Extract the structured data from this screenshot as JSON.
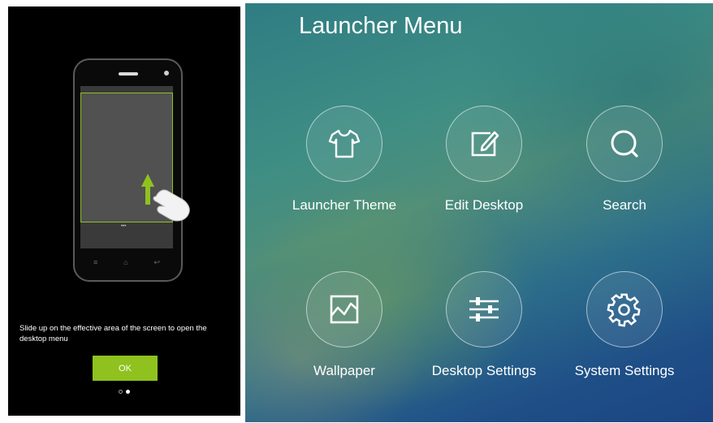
{
  "tutorial": {
    "instruction": "Slide up on the effective area of the screen to open the desktop menu",
    "ok_label": "OK",
    "phone_page_dots": "•••"
  },
  "launcher_menu": {
    "title": "Launcher Menu",
    "items": [
      {
        "label": "Launcher Theme",
        "icon": "tshirt-icon"
      },
      {
        "label": "Edit Desktop",
        "icon": "edit-icon"
      },
      {
        "label": "Search",
        "icon": "search-icon"
      },
      {
        "label": "Wallpaper",
        "icon": "wallpaper-icon"
      },
      {
        "label": "Desktop Settings",
        "icon": "sliders-icon"
      },
      {
        "label": "System Settings",
        "icon": "gear-icon"
      }
    ]
  },
  "colors": {
    "accent_green": "#8fc21e"
  }
}
